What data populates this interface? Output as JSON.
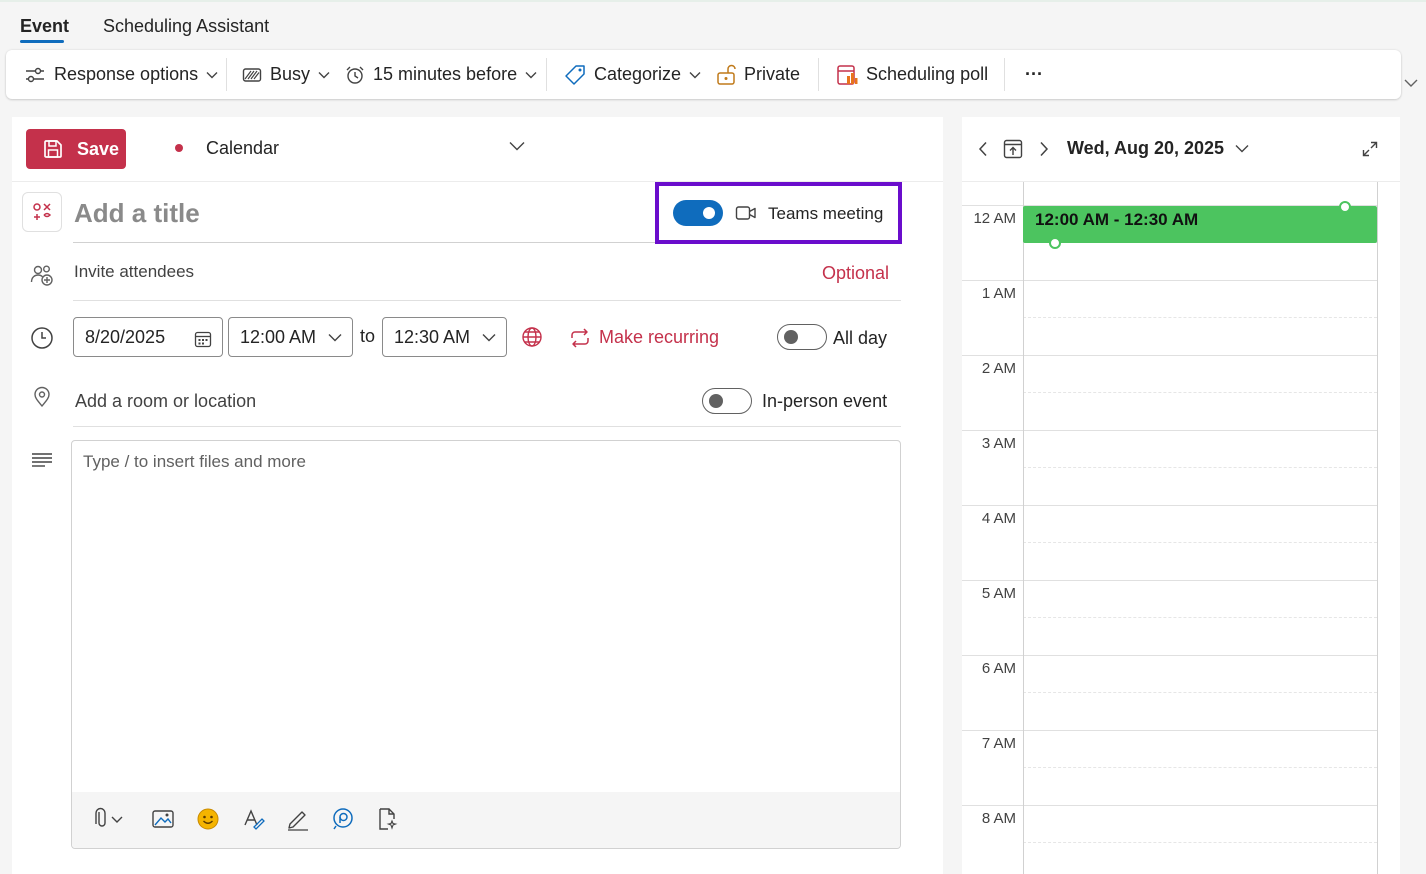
{
  "tabs": [
    {
      "label": "Event",
      "active": true
    },
    {
      "label": "Scheduling Assistant",
      "active": false
    }
  ],
  "ribbon": {
    "response_options": "Response options",
    "show_as": "Busy",
    "reminder": "15 minutes before",
    "categorize": "Categorize",
    "private": "Private",
    "scheduling_poll": "Scheduling poll",
    "more": "···"
  },
  "form": {
    "save_label": "Save",
    "calendar_label": "Calendar",
    "title_placeholder": "Add a title",
    "teams_meeting_label": "Teams meeting",
    "teams_meeting_on": true,
    "invite_placeholder": "Invite attendees",
    "optional_label": "Optional",
    "start_date": "8/20/2025",
    "start_time": "12:00 AM",
    "to_label": "to",
    "end_time": "12:30 AM",
    "make_recurring": "Make recurring",
    "all_day_label": "All day",
    "all_day_on": false,
    "location_placeholder": "Add a room or location",
    "in_person_label": "In-person event",
    "in_person_on": false,
    "body_placeholder": "Type / to insert files and more"
  },
  "day_view": {
    "date_label": "Wed, Aug 20, 2025",
    "hours": [
      "12 AM",
      "1 AM",
      "2 AM",
      "3 AM",
      "4 AM",
      "5 AM",
      "6 AM",
      "7 AM",
      "8 AM"
    ],
    "event_time": "12:00 AM - 12:30 AM"
  },
  "colors": {
    "accent": "#0f6cbd",
    "save": "#c4314b",
    "event": "#4cc45f",
    "highlight": "#6a0dcc"
  }
}
